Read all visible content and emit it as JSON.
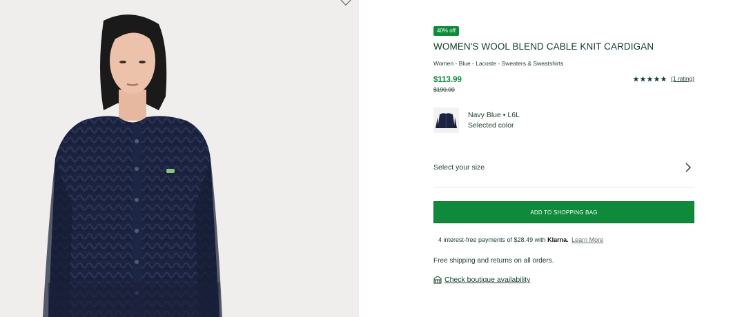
{
  "product": {
    "badge": "40% off",
    "title": "WOMEN'S WOOL BLEND CABLE KNIT CARDIGAN",
    "breadcrumb": "Women - Blue - Lacoste - Sweaters & Sweatshirts",
    "price": "$113.99",
    "original_price": "$190.00",
    "rating_count": "(1 rating)",
    "rating_stars": 5
  },
  "color": {
    "name": "Navy Blue • L6L",
    "status": "Selected color"
  },
  "size": {
    "label": "Select your size"
  },
  "actions": {
    "add_to_bag": "ADD TO SHOPPING BAG"
  },
  "klarna": {
    "text": "4 interest-free payments of $28.49 with",
    "brand": "Klarna.",
    "learn_more": "Learn More"
  },
  "shipping": "Free shipping and returns on all orders.",
  "boutique": "Check boutique availability",
  "colors": {
    "brand_green": "#0e8a3a",
    "text_dark_green": "#123d27",
    "navy": "#1c2340"
  },
  "icons": [
    "heart-icon",
    "star-icon",
    "chevron-right-icon",
    "store-icon"
  ]
}
